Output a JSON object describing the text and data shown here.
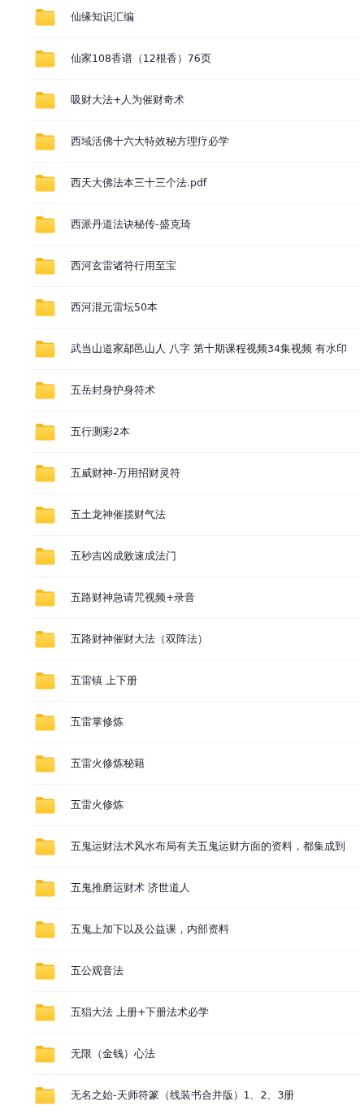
{
  "folders": [
    {
      "name": "仙缘知识汇编"
    },
    {
      "name": "仙家108香谱（12根香）76页"
    },
    {
      "name": "吸财大法+人为催财奇术"
    },
    {
      "name": "西域活佛十六大特效秘方理疗必学"
    },
    {
      "name": "西天大佛法本三十三个法.pdf"
    },
    {
      "name": "西派丹道法诀秘传-盛克琦"
    },
    {
      "name": "西河玄雷诸符行用至宝"
    },
    {
      "name": "西河混元雷坛50本"
    },
    {
      "name": "武当山道家鄗邑山人 八字 第十期课程视频34集视频 有水印"
    },
    {
      "name": "五岳封身护身符术"
    },
    {
      "name": "五行测彩2本"
    },
    {
      "name": "五威财神-万用招财灵符"
    },
    {
      "name": "五土龙神催揽财气法"
    },
    {
      "name": "五秒吉凶成败速成法门"
    },
    {
      "name": "五路财神急请咒视频+录音"
    },
    {
      "name": "五路财神催财大法（双阵法）"
    },
    {
      "name": "五雷镇 上下册"
    },
    {
      "name": "五雷掌修炼"
    },
    {
      "name": "五雷火修炼秘籍"
    },
    {
      "name": "五雷火修炼"
    },
    {
      "name": "五鬼运财法术风水布局有关五鬼运财方面的资料，都集成到"
    },
    {
      "name": "五鬼推磨运财术 济世道人"
    },
    {
      "name": "五鬼上加下以及公益课，内部资料"
    },
    {
      "name": "五公观音法"
    },
    {
      "name": "五猖大法 上册+下册法术必学"
    },
    {
      "name": "无限（金钱）心法"
    },
    {
      "name": "无名之始-天师符篆（线装书合并版）1、2、3册"
    }
  ]
}
